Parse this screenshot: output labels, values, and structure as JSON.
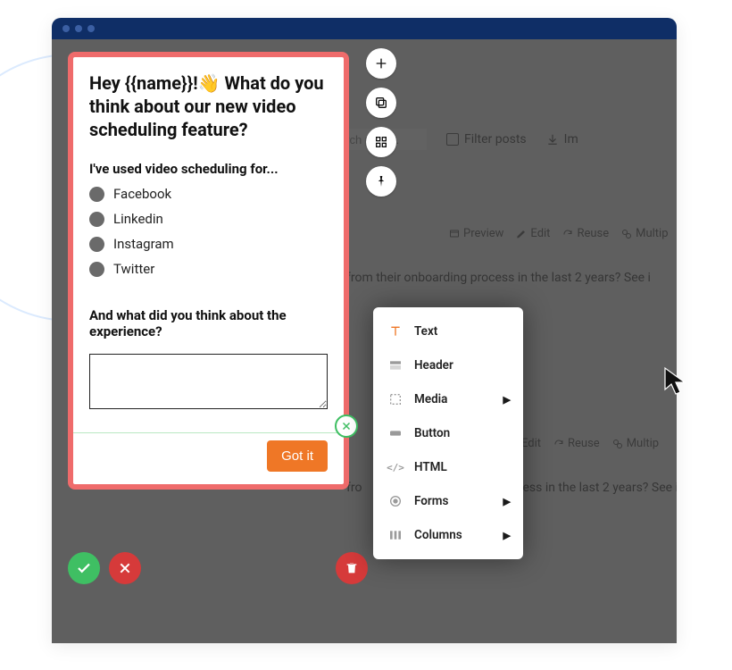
{
  "survey": {
    "title_part1": "Hey {{name}}!",
    "title_part2": " What do you think about our new video scheduling feature?",
    "question1": "I've used video scheduling for...",
    "options": [
      "Facebook",
      "Linkedin",
      "Instagram",
      "Twitter"
    ],
    "question2": "And what did you think about the experience?",
    "cta": "Got it"
  },
  "popover": {
    "items": [
      {
        "label": "Text",
        "icon": "text-icon",
        "submenu": false
      },
      {
        "label": "Header",
        "icon": "header-icon",
        "submenu": false
      },
      {
        "label": "Media",
        "icon": "media-icon",
        "submenu": true
      },
      {
        "label": "Button",
        "icon": "button-icon",
        "submenu": false
      },
      {
        "label": "HTML",
        "icon": "html-icon",
        "submenu": false
      },
      {
        "label": "Forms",
        "icon": "forms-icon",
        "submenu": true
      },
      {
        "label": "Columns",
        "icon": "columns-icon",
        "submenu": true
      }
    ]
  },
  "toolbar": {
    "search_placeholder": "Search posts..",
    "filter_label": "Filter posts",
    "import_label": "Im"
  },
  "post_actions": {
    "preview": "Preview",
    "edit": "Edit",
    "reuse": "Reuse",
    "multip": "Multip"
  },
  "post_snippet": "from their onboarding process in the last 2 years? See i",
  "post_snippet2_left": "fro",
  "post_snippet2_right": "ess in the last 2 years? See i"
}
